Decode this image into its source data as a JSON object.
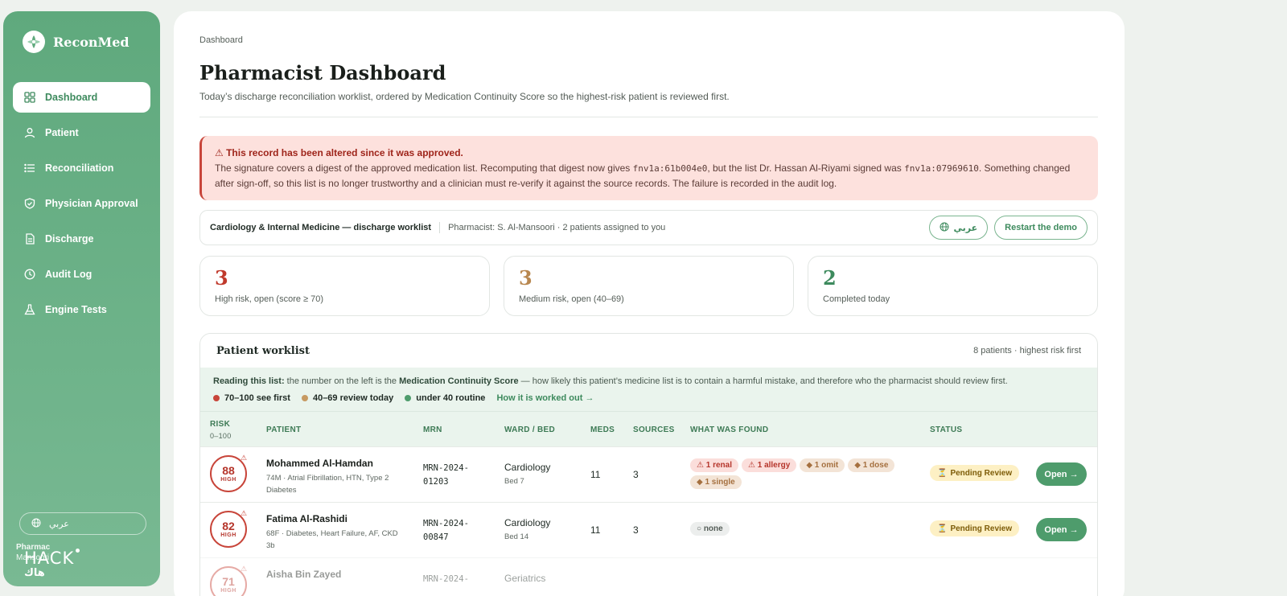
{
  "app": {
    "name": "ReconMed"
  },
  "sidebar": {
    "items": [
      {
        "label": "Dashboard",
        "icon": "grid-icon",
        "active": true
      },
      {
        "label": "Patient",
        "icon": "user-icon",
        "active": false
      },
      {
        "label": "Reconciliation",
        "icon": "list-icon",
        "active": false
      },
      {
        "label": "Physician Approval",
        "icon": "shield-check-icon",
        "active": false
      },
      {
        "label": "Discharge",
        "icon": "document-icon",
        "active": false
      },
      {
        "label": "Audit Log",
        "icon": "clock-icon",
        "active": false
      },
      {
        "label": "Engine Tests",
        "icon": "flask-icon",
        "active": false
      }
    ],
    "language": "عربي",
    "user_role": "Pharmac",
    "user_name": "Mansoori",
    "watermark": {
      "text": "HACK",
      "arabic": "هاك"
    }
  },
  "header": {
    "breadcrumb": "Dashboard",
    "title": "Pharmacist Dashboard",
    "subtitle": "Today’s discharge reconciliation worklist, ordered by Medication Continuity Score so the highest-risk patient is reviewed first."
  },
  "alert": {
    "title": "⚠ This record has been altered since it was approved.",
    "text_1": "The signature covers a digest of the approved medication list. Recomputing that digest now gives ",
    "digest_now": "fnv1a:61b004e0",
    "text_2": ", but the list Dr. Hassan Al-Riyami signed was ",
    "digest_signed": "fnv1a:07969610",
    "text_3": ". Something changed after sign-off, so this list is no longer trustworthy and a clinician must re-verify it against the source records. The failure is recorded in the audit log."
  },
  "context": {
    "title": "Cardiology & Internal Medicine — discharge worklist",
    "meta": "Pharmacist: S. Al-Mansoori · 2 patients assigned to you",
    "lang_button": "عربي",
    "restart_button": "Restart the demo"
  },
  "stats": [
    {
      "value": "3",
      "label": "High risk, open (score ≥ 70)",
      "color": "#c0392b"
    },
    {
      "value": "3",
      "label": "Medium risk, open (40–69)",
      "color": "#b8874f"
    },
    {
      "value": "2",
      "label": "Completed today",
      "color": "#3d8a5d"
    }
  ],
  "worklist": {
    "title": "Patient worklist",
    "count": "8 patients · highest risk first",
    "legend_intro_bold": "Reading this list:",
    "legend_intro_1": " the number on the left is the ",
    "legend_intro_term": "Medication Continuity Score",
    "legend_intro_2": " — how likely this patient’s medicine list is to contain a harmful mistake, and therefore who the pharmacist should review first.",
    "legend": [
      {
        "label": "70–100 see first",
        "color": "#c8453a"
      },
      {
        "label": "40–69 review today",
        "color": "#c79a62"
      },
      {
        "label": "under 40 routine",
        "color": "#4e9c6c"
      }
    ],
    "legend_link": "How it is worked out →",
    "columns": {
      "risk": "RISK",
      "risk_sub": "0–100",
      "patient": "PATIENT",
      "mrn": "MRN",
      "ward": "WARD / BED",
      "meds": "MEDS",
      "sources": "SOURCES",
      "found": "WHAT WAS FOUND",
      "status": "STATUS"
    },
    "rows": [
      {
        "score": "88",
        "level": "HIGH",
        "name": "Mohammed Al-Hamdan",
        "meta": "74M · Atrial Fibrillation, HTN, Type 2 Diabetes",
        "mrn": "MRN-2024-01203",
        "ward": "Cardiology",
        "bed": "Bed 7",
        "meds": "11",
        "sources": "3",
        "findings": [
          {
            "label": "⚠ 1 renal",
            "kind": "red"
          },
          {
            "label": "⚠ 1 allergy",
            "kind": "red"
          },
          {
            "label": "◆ 1 omit",
            "kind": "amber"
          },
          {
            "label": "◆ 1 dose",
            "kind": "amber"
          },
          {
            "label": "◆ 1 single",
            "kind": "amber"
          }
        ],
        "status": "Pending Review",
        "action": "Open →"
      },
      {
        "score": "82",
        "level": "HIGH",
        "name": "Fatima Al-Rashidi",
        "meta": "68F · Diabetes, Heart Failure, AF, CKD 3b",
        "mrn": "MRN-2024-00847",
        "ward": "Cardiology",
        "bed": "Bed 14",
        "meds": "11",
        "sources": "3",
        "findings": [
          {
            "label": "○ none",
            "kind": "none"
          }
        ],
        "status": "Pending Review",
        "action": "Open →"
      },
      {
        "score": "71",
        "level": "HIGH",
        "name": "Aisha Bin Zayed",
        "meta": "",
        "mrn": "MRN-2024-",
        "ward": "Geriatrics",
        "bed": "",
        "meds": "",
        "sources": "",
        "findings": [],
        "status": "",
        "action": ""
      }
    ]
  }
}
